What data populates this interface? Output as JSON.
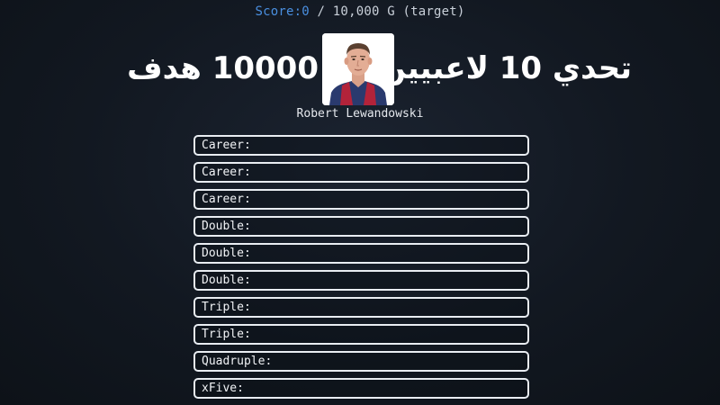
{
  "header": {
    "score_label": "Score:",
    "score_value": "0",
    "target_text": " / 10,000 G (target)"
  },
  "title": {
    "left_text": "10000 هدف",
    "right_text": "تحدي 10 لاعبيين"
  },
  "player": {
    "name": "Robert Lewandowski",
    "photo_icon": "player-portrait-icon"
  },
  "slots": [
    {
      "label": "Career:"
    },
    {
      "label": "Career:"
    },
    {
      "label": "Career:"
    },
    {
      "label": "Double:"
    },
    {
      "label": "Double:"
    },
    {
      "label": "Double:"
    },
    {
      "label": "Triple:"
    },
    {
      "label": "Triple:"
    },
    {
      "label": "Quadruple:"
    },
    {
      "label": "xFive:"
    }
  ],
  "colors": {
    "score_accent": "#4a8fe0",
    "slot_border": "#e9edf2",
    "background": "#121821"
  }
}
